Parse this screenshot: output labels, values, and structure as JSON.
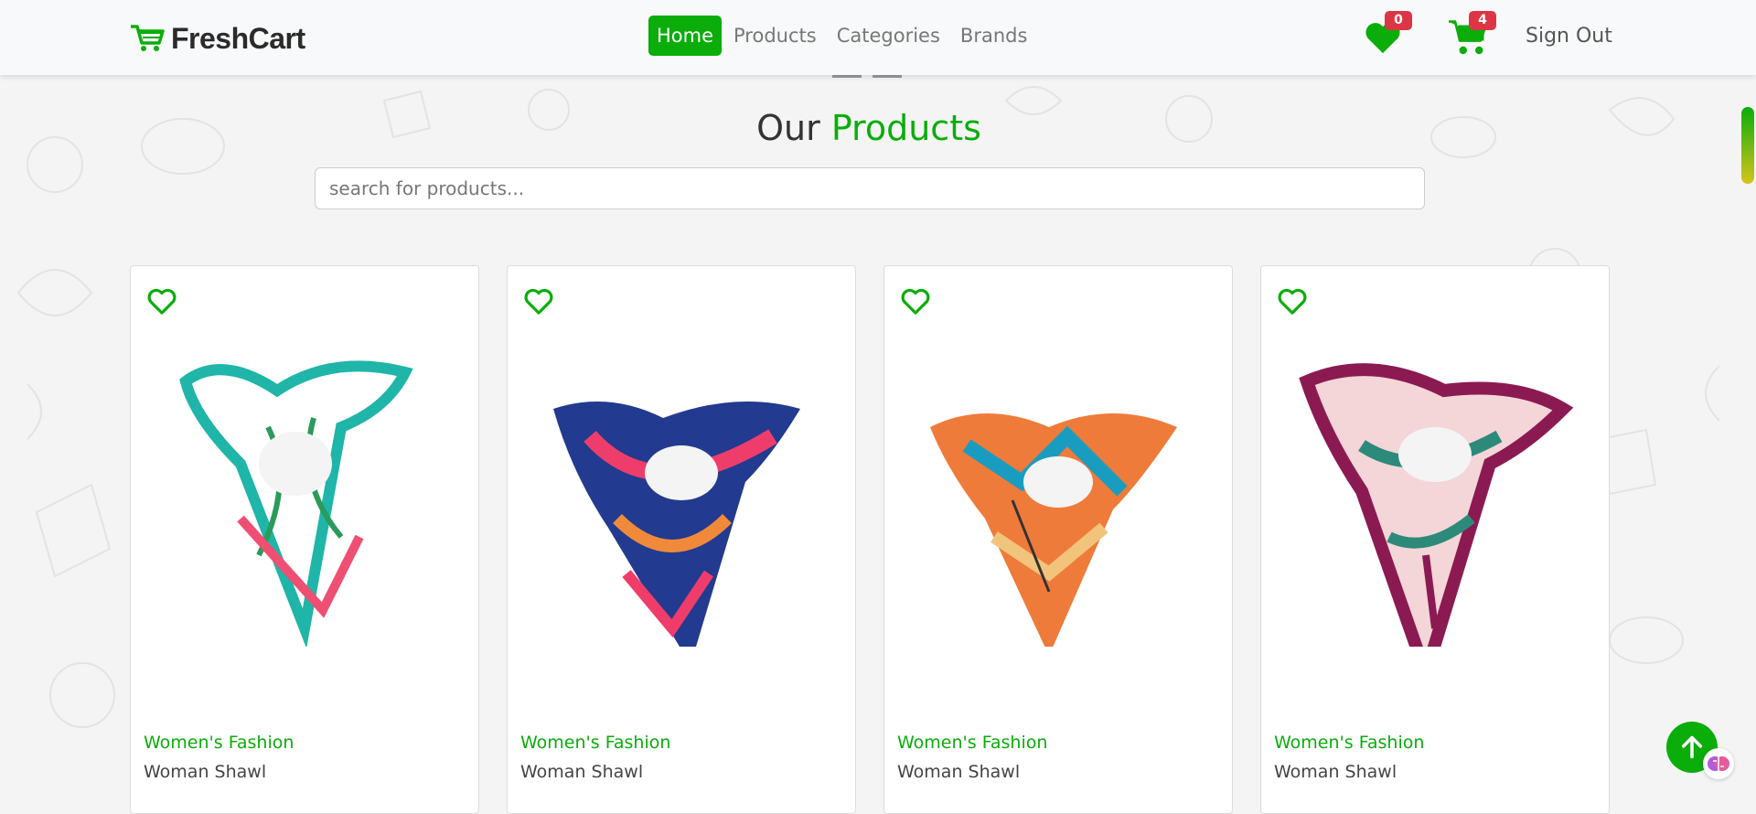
{
  "brand": {
    "name": "FreshCart",
    "icon": "cart-logo-icon",
    "color": "#0aad0a"
  },
  "nav": {
    "links": [
      {
        "label": "Home",
        "active": true
      },
      {
        "label": "Products",
        "active": false
      },
      {
        "label": "Categories",
        "active": false
      },
      {
        "label": "Brands",
        "active": false
      }
    ],
    "wishlist_count": "0",
    "cart_count": "4",
    "signout_label": "Sign Out"
  },
  "main": {
    "title_part1": "Our",
    "title_part2": "Products",
    "search_placeholder": "search for products...",
    "products": [
      {
        "category": "Women's Fashion",
        "name": "Woman Shawl",
        "scarf_colors": [
          "#ffffff",
          "#1fb5a8",
          "#ef4f72"
        ]
      },
      {
        "category": "Women's Fashion",
        "name": "Woman Shawl",
        "scarf_colors": [
          "#223a8f",
          "#ef3d6b",
          "#f08a3a"
        ]
      },
      {
        "category": "Women's Fashion",
        "name": "Woman Shawl",
        "scarf_colors": [
          "#ef7b3a",
          "#1a9cc0",
          "#f2c47b"
        ]
      },
      {
        "category": "Women's Fashion",
        "name": "Woman Shawl",
        "scarf_colors": [
          "#8b1a52",
          "#f4d6d8",
          "#2d8a7a"
        ]
      }
    ]
  },
  "colors": {
    "accent": "#0aad0a",
    "badge": "#dc3545"
  }
}
